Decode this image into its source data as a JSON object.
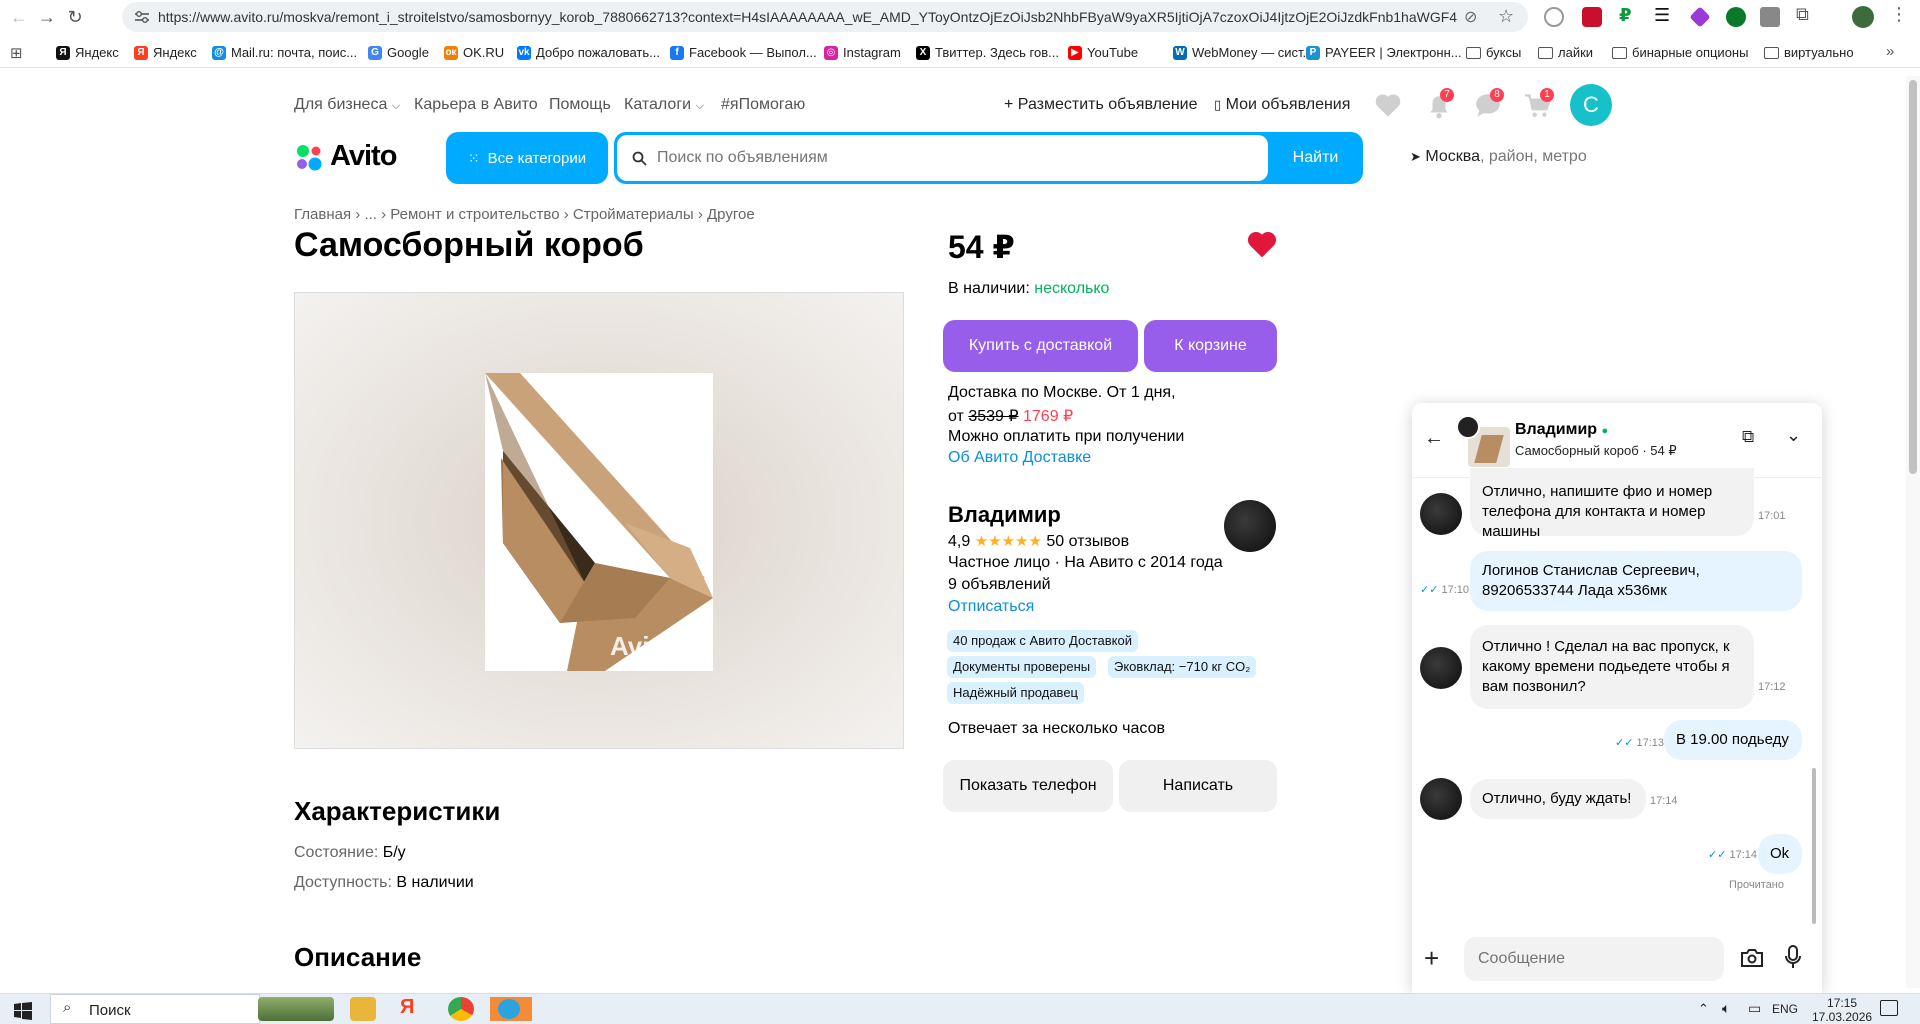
{
  "browser": {
    "url": "https://www.avito.ru/moskva/remont_i_stroitelstvo/samosbornyy_korob_7880662713?context=H4sIAAAAAAAA_wE_AMD_YToyOntzOjEzOiJsb2NhbFByaW9yaXR5IjtiOjA7czoxOiJ4IjtzOjE2OiJzdkFnb1haWGF4S2w...",
    "bookmarks": [
      {
        "label": "Яндекс",
        "color": "#111111",
        "glyph": "Я"
      },
      {
        "label": "Яндекс",
        "color": "#fc3f1d",
        "glyph": "Я"
      },
      {
        "label": "Mail.ru: почта, поис...",
        "color": "#168de2",
        "glyph": "@"
      },
      {
        "label": "Google",
        "color": "#4285f4",
        "glyph": "G"
      },
      {
        "label": "OK.RU",
        "color": "#ee8208",
        "glyph": "ок"
      },
      {
        "label": "Добро пожаловать...",
        "color": "#0077ff",
        "glyph": "vk"
      },
      {
        "label": "Facebook — Выпол...",
        "color": "#1877f2",
        "glyph": "f"
      },
      {
        "label": "Instagram",
        "color": "#d6249f",
        "glyph": "◎"
      },
      {
        "label": "Твиттер. Здесь гов...",
        "color": "#000000",
        "glyph": "X"
      },
      {
        "label": "YouTube",
        "color": "#ff0000",
        "glyph": "▶"
      },
      {
        "label": "WebMoney — сист...",
        "color": "#036cb5",
        "glyph": "W"
      },
      {
        "label": "PAYEER | Электронн...",
        "color": "#1c93d1",
        "glyph": "P"
      },
      {
        "label": "буксы",
        "folder": true
      },
      {
        "label": "лайки",
        "folder": true
      },
      {
        "label": "бинарные опционы",
        "folder": true
      },
      {
        "label": "виртуально",
        "folder": true
      }
    ]
  },
  "header": {
    "links": [
      "Для бизнеса",
      "Карьера в Авито",
      "Помощь",
      "Каталоги",
      "#яПомогаю"
    ],
    "post_ad": "Разместить объявление",
    "my_ads": "Мои объявления",
    "notifications_count": "7",
    "messages_count": "8",
    "cart_count": "1",
    "avatar_letter": "С",
    "logo": "Avito",
    "all_categories": "Все категории",
    "search_placeholder": "Поиск по объявлениям",
    "search_button": "Найти",
    "location_city": "Москва",
    "location_rest": ", район, метро"
  },
  "breadcrumb": [
    "Главная",
    "...",
    "Ремонт и строительство",
    "Стройматериалы",
    "Другое"
  ],
  "product": {
    "title": "Самосборный короб",
    "watermark": "Avito",
    "price": "54 ₽",
    "stock_label": "В наличии: ",
    "stock_value": "несколько",
    "buy_delivery": "Купить с доставкой",
    "to_cart": "К корзине",
    "delivery_line1": "Доставка по Москве. От 1 дня,",
    "delivery_from": "от ",
    "delivery_old": "3539 ₽",
    "delivery_new": "1769 ₽",
    "pay_on_receipt": "Можно оплатить при получении",
    "about_delivery": "Об Авито Доставке",
    "characteristics_title": "Характеристики",
    "characteristics": [
      {
        "label": "Состояние: ",
        "value": "Б/у"
      },
      {
        "label": "Доступность: ",
        "value": "В наличии"
      }
    ],
    "description_title": "Описание"
  },
  "seller": {
    "name": "Владимир",
    "rating": "4,9",
    "stars": "★★★★★",
    "rating_value": 4.9,
    "reviews": "50 отзывов",
    "type": "Частное лицо · На Авито с 2014 года",
    "ads": "9 объявлений",
    "unsubscribe": "Отписаться",
    "chips": [
      "40 продаж с Авито Доставкой",
      "Документы проверены",
      "Эковклад: −710 кг CO₂",
      "Надёжный продавец"
    ],
    "response": "Отвечает за несколько часов",
    "show_phone": "Показать телефон",
    "write": "Написать"
  },
  "chat": {
    "name": "Владимир",
    "subtitle": "Самосборный короб · 54 ₽",
    "messages": [
      {
        "dir": "in",
        "text": "Отлично, напишите фио и номер телефона для контакта и номер машины",
        "time": "17:01"
      },
      {
        "dir": "out",
        "text": "Логинов Станислав Сергеевич, 89206533744 Лада х536мк",
        "time": "17:10"
      },
      {
        "dir": "in",
        "text": "Отлично ! Сделал на вас пропуск, к какому времени подьедете чтобы я вам позвонил?",
        "time": "17:12"
      },
      {
        "dir": "out",
        "text": "В 19.00 подьеду",
        "time": "17:13"
      },
      {
        "dir": "in",
        "text": "Отлично, буду ждать!",
        "time": "17:14"
      },
      {
        "dir": "out",
        "text": "Ok",
        "time": "17:14"
      }
    ],
    "read_status": "Прочитано",
    "input_placeholder": "Сообщение"
  },
  "taskbar": {
    "search": "Поиск",
    "lang": "ENG",
    "time": "17:15",
    "date": "17.03.2026"
  },
  "colors": {
    "accent": "#00aaff",
    "purple": "#965eeb",
    "green": "#02b35b",
    "red": "#ff4053",
    "heart": "#e0173a"
  }
}
